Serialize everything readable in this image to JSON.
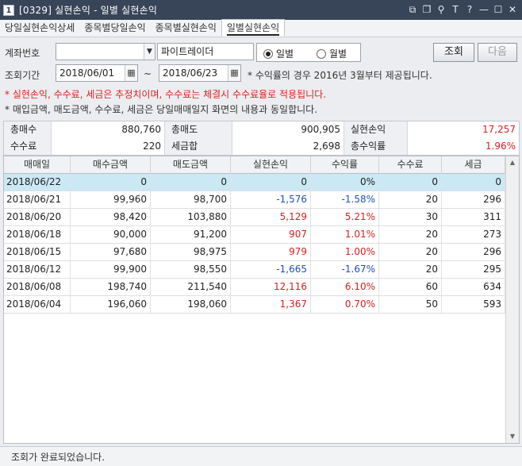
{
  "window": {
    "number": "1",
    "title": "[0329] 실현손익 - 일별 실현손익",
    "icons": [
      "layout-icon",
      "copy-icon",
      "pin-icon",
      "font-icon",
      "help-icon",
      "minimize-icon",
      "maximize-icon",
      "close-icon"
    ],
    "icon_glyphs": [
      "⧉",
      "❐",
      "⚲",
      "T",
      "?",
      "—",
      "☐",
      "✕"
    ]
  },
  "tabs": [
    {
      "label": "당일실현손익상세",
      "active": false
    },
    {
      "label": "종목별당일손익",
      "active": false
    },
    {
      "label": "종목별실현손익",
      "active": false
    },
    {
      "label": "일별실현손익",
      "active": true
    }
  ],
  "query": {
    "account_label": "계좌번호",
    "account_value": "",
    "account_name": "파이트레이더",
    "period_label": "조회기간",
    "date_from": "2018/06/01",
    "tilde": "~",
    "date_to": "2018/06/23",
    "radio_daily": "일별",
    "radio_monthly": "월별",
    "radio_selected": "daily",
    "notice_rate": "* 수익률의 경우 2016년 3월부터 제공됩니다.",
    "search_button": "조회",
    "next_button": "다음",
    "notice_red": "* 실현손익, 수수료, 세금은 추정치이며, 수수료는 체결시 수수료율로 적용됩니다.",
    "notice_dark": "* 매입금액, 매도금액, 수수료, 세금은 당일매매일지 화면의 내용과 동일합니다."
  },
  "summary": {
    "total_buy_label": "총매수",
    "total_buy": "880,760",
    "total_sell_label": "총매도",
    "total_sell": "900,905",
    "realized_label": "실현손익",
    "realized": "17,257",
    "fee_label": "수수료",
    "fee": "220",
    "tax_label": "세금합",
    "tax": "2,698",
    "total_return_label": "총수익률",
    "total_return": "1.96%"
  },
  "grid": {
    "headers": [
      "매매일",
      "매수금액",
      "매도금액",
      "실현손익",
      "수익률",
      "수수료",
      "세금"
    ],
    "rows": [
      {
        "date": "2018/06/22",
        "buy": "0",
        "sell": "0",
        "pnl": "0",
        "rate": "0%",
        "fee": "0",
        "tax": "0",
        "sign": "zero",
        "selected": true
      },
      {
        "date": "2018/06/21",
        "buy": "99,960",
        "sell": "98,700",
        "pnl": "-1,576",
        "rate": "-1.58%",
        "fee": "20",
        "tax": "296",
        "sign": "neg",
        "selected": false
      },
      {
        "date": "2018/06/20",
        "buy": "98,420",
        "sell": "103,880",
        "pnl": "5,129",
        "rate": "5.21%",
        "fee": "30",
        "tax": "311",
        "sign": "pos",
        "selected": false
      },
      {
        "date": "2018/06/18",
        "buy": "90,000",
        "sell": "91,200",
        "pnl": "907",
        "rate": "1.01%",
        "fee": "20",
        "tax": "273",
        "sign": "pos",
        "selected": false
      },
      {
        "date": "2018/06/15",
        "buy": "97,680",
        "sell": "98,975",
        "pnl": "979",
        "rate": "1.00%",
        "fee": "20",
        "tax": "296",
        "sign": "pos",
        "selected": false
      },
      {
        "date": "2018/06/12",
        "buy": "99,900",
        "sell": "98,550",
        "pnl": "-1,665",
        "rate": "-1.67%",
        "fee": "20",
        "tax": "295",
        "sign": "neg",
        "selected": false
      },
      {
        "date": "2018/06/08",
        "buy": "198,740",
        "sell": "211,540",
        "pnl": "12,116",
        "rate": "6.10%",
        "fee": "60",
        "tax": "634",
        "sign": "pos",
        "selected": false
      },
      {
        "date": "2018/06/04",
        "buy": "196,060",
        "sell": "198,060",
        "pnl": "1,367",
        "rate": "0.70%",
        "fee": "50",
        "tax": "593",
        "sign": "pos",
        "selected": false
      }
    ]
  },
  "status": {
    "message": "조회가 완료되었습니다."
  },
  "colors": {
    "title_bar": "#384458",
    "positive": "#d92020",
    "negative": "#1f4fbf",
    "selected_row": "#cbe8f5"
  }
}
